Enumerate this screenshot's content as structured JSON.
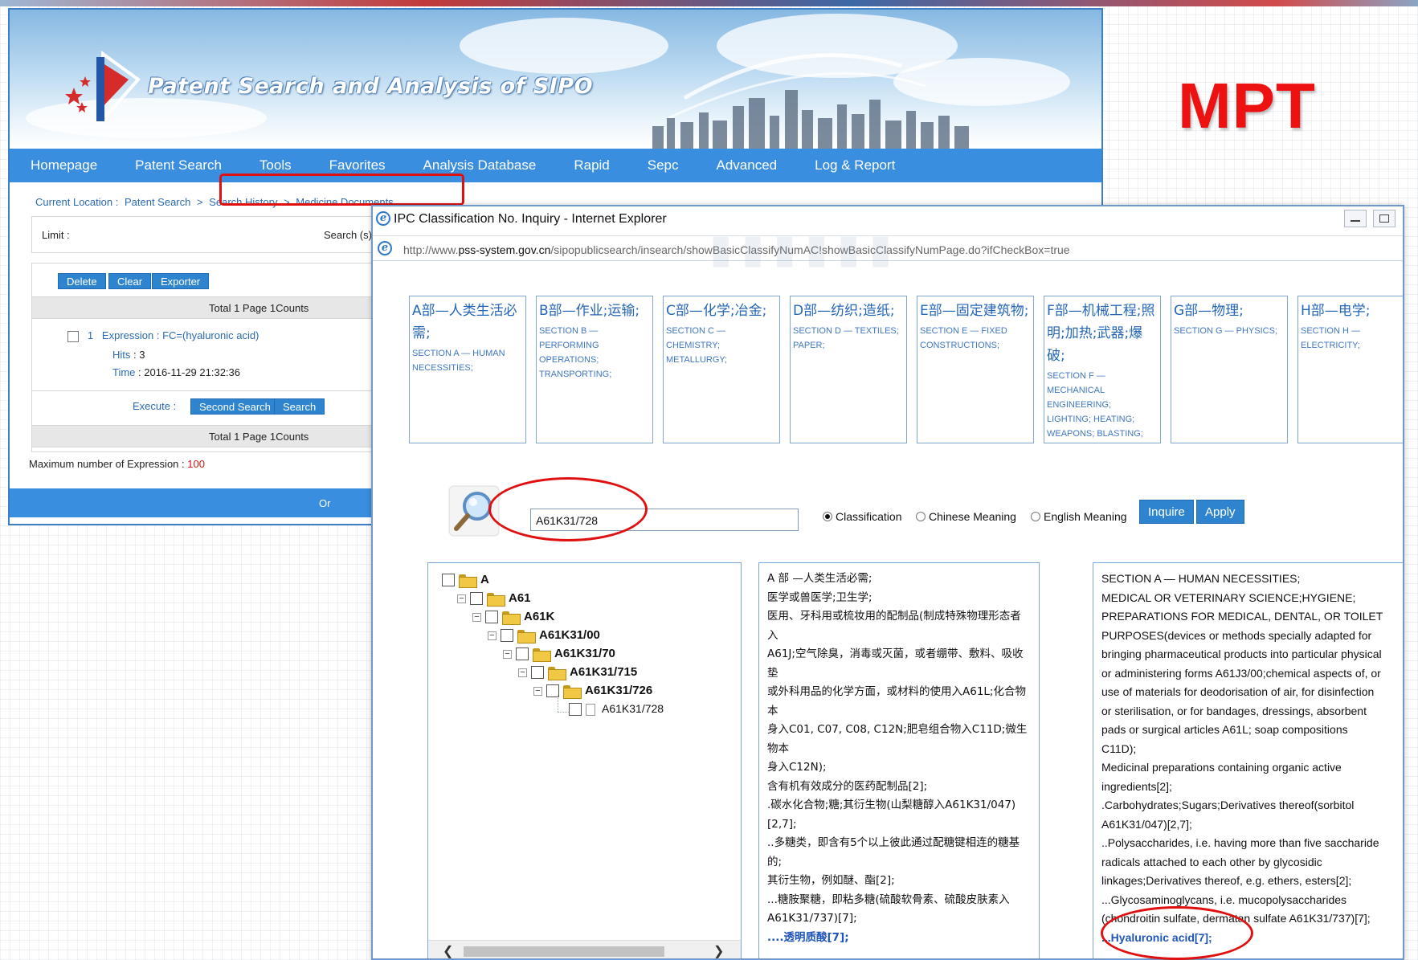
{
  "sipo": {
    "site_title": "Patent Search and Analysis of SIPO",
    "nav": [
      "Homepage",
      "Patent Search",
      "Tools",
      "Favorites",
      "Analysis Database",
      "Rapid",
      "Sepc",
      "Advanced",
      "Log & Report"
    ],
    "breadcrumb": {
      "prefix": "Current Location :",
      "items": [
        "Patent Search",
        ">",
        "Search History",
        ">",
        "Medicine Documents"
      ]
    },
    "limit_label": "Limit :",
    "search_label": "Search (s)",
    "buttons": {
      "delete": "Delete",
      "clear": "Clear",
      "exporter": "Exporter"
    },
    "total_text": "Total 1 Page 1Counts",
    "entry": {
      "index": "1",
      "expression_label": "Expression :",
      "expression": "FC=(hyaluronic acid)",
      "hits_label": "Hits",
      "hits": ": 3",
      "time_label": "Time",
      "time": ": 2016-11-29 21:32:36"
    },
    "execute_label": "Execute :",
    "second_search": "Second Search",
    "search": "Search",
    "max_expr_label": "Maximum number of Expression :",
    "max_expr_value": "100",
    "footer_text": "Or"
  },
  "mpt_label": "MPT",
  "ie": {
    "window_title": "IPC Classification No. Inquiry - Internet Explorer",
    "url_prefix": "http://www.",
    "url_domain": "pss-system.gov.cn",
    "url_path": "/sipopublicsearch/insearch/showBasicClassifyNumAC!showBasicClassifyNumPage.do?ifCheckBox=true",
    "sections": [
      {
        "zh": "A部—人类生活必需;",
        "en": "SECTION A — HUMAN NECESSITIES;"
      },
      {
        "zh": "B部—作业;运输;",
        "en": "SECTION B — PERFORMING OPERATIONS; TRANSPORTING;"
      },
      {
        "zh": "C部—化学;冶金;",
        "en": "SECTION C — CHEMISTRY; METALLURGY;"
      },
      {
        "zh": "D部—纺织;造纸;",
        "en": "SECTION D — TEXTILES; PAPER;"
      },
      {
        "zh": "E部—固定建筑物;",
        "en": "SECTION E — FIXED CONSTRUCTIONS;"
      },
      {
        "zh": "F部—机械工程;照明;加热;武器;爆破;",
        "en": "SECTION F — MECHANICAL ENGINEERING; LIGHTING; HEATING; WEAPONS; BLASTING;"
      },
      {
        "zh": "G部—物理;",
        "en": "SECTION G — PHYSICS;"
      },
      {
        "zh": "H部—电学;",
        "en": "SECTION H — ELECTRICITY;"
      }
    ],
    "query_value": "A61K31/728",
    "radios": [
      {
        "label": "Classification",
        "checked": true
      },
      {
        "label": "Chinese Meaning",
        "checked": false
      },
      {
        "label": "English Meaning",
        "checked": false
      }
    ],
    "inquire_button": "Inquire",
    "apply_button": "Apply",
    "tree": [
      {
        "label": "A",
        "level": 0,
        "icon": "folder-icon"
      },
      {
        "label": "A61",
        "level": 1,
        "icon": "folder-icon"
      },
      {
        "label": "A61K",
        "level": 2,
        "icon": "folder-icon"
      },
      {
        "label": "A61K31/00",
        "level": 3,
        "icon": "folder-icon"
      },
      {
        "label": "A61K31/70",
        "level": 4,
        "icon": "folder-icon"
      },
      {
        "label": "A61K31/715",
        "level": 5,
        "icon": "folder-icon"
      },
      {
        "label": "A61K31/726",
        "level": 6,
        "icon": "folder-icon"
      },
      {
        "label": "A61K31/728",
        "level": 7,
        "icon": "file-icon"
      }
    ],
    "zh_lines": [
      "A 部 —人类生活必需;",
      "医学或兽医学;卫生学;",
      "医用、牙科用或梳妆用的配制品(制成特殊物理形态者入",
      "A61J;空气除臭，消毒或灭菌，或者绷带、敷料、吸收垫",
      "或外科用品的化学方面，或材料的使用入A61L;化合物本",
      "身入C01, C07, C08, C12N;肥皂组合物入C11D;微生物本",
      "身入C12N);",
      "含有机有效成分的医药配制品[2];",
      ".碳水化合物;糖;其衍生物(山梨糖醇入A61K31/047)[2,7];",
      "..多糖类，即含有5个以上彼此通过配糖键相连的糖基的;",
      "其衍生物，例如醚、酯[2];",
      "...糖胺聚糖，即粘多糖(硫酸软骨素、硫酸皮肤素入",
      "A61K31/737)[7];"
    ],
    "zh_highlight": "....透明质酸[7];",
    "en_lines": [
      "SECTION A — HUMAN NECESSITIES;",
      "MEDICAL OR VETERINARY SCIENCE;HYGIENE;",
      "PREPARATIONS FOR MEDICAL, DENTAL, OR TOILET",
      "PURPOSES(devices or methods specially adapted for",
      "bringing pharmaceutical products into particular physical",
      "or administering forms A61J3/00;chemical aspects of, or",
      "use of materials for deodorisation of air, for disinfection",
      "or sterilisation, or for bandages, dressings, absorbent",
      "pads or surgical articles A61L; soap compositions",
      "C11D);",
      "Medicinal preparations containing organic active",
      "ingredients[2];",
      ".Carbohydrates;Sugars;Derivatives thereof(sorbitol",
      "A61K31/047)[2,7];",
      "..Polysaccharides, i.e. having more than five saccharide",
      "radicals attached to each other by glycosidic",
      "linkages;Derivatives thereof, e.g. ethers, esters[2];",
      "...Glycosaminoglycans, i.e. mucopolysaccharides",
      "(chondroitin sulfate, dermatan sulfate A61K31/737)[7];"
    ],
    "en_highlight": "...Hyaluronic acid[7];"
  },
  "colors": {
    "nav_blue": "#3a8ee0",
    "link_blue": "#2a6ab1",
    "annotation_red": "#e01010",
    "mpt_red": "#ee1111"
  }
}
